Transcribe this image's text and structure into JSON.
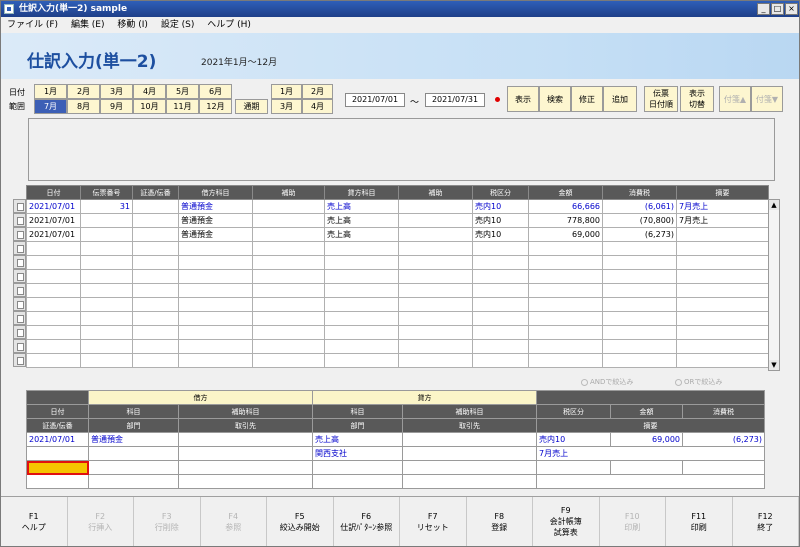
{
  "window": {
    "title": "仕訳入力(単一2) sample",
    "controls": [
      "_",
      "□",
      "×"
    ]
  },
  "menu": [
    "ファイル (F)",
    "編集 (E)",
    "移動 (I)",
    "設定 (S)",
    "ヘルプ (H)"
  ],
  "header": {
    "title": "仕訳入力(単一2)",
    "period": "2021年1月～12月"
  },
  "date_range": {
    "label1": "日付",
    "label2": "範囲",
    "months_row1": [
      "1月",
      "2月",
      "3月",
      "4月",
      "5月",
      "6月"
    ],
    "months_row2": [
      "7月",
      "8月",
      "9月",
      "10月",
      "11月",
      "12月"
    ],
    "selected_month": "7月",
    "period_button": "通期",
    "quarter_row1": [
      "1月",
      "2月"
    ],
    "quarter_row2": [
      "3月",
      "4月"
    ],
    "from": "2021/07/01",
    "tilde": "～",
    "to": "2021/07/31"
  },
  "toolbar": {
    "display": "表示",
    "search": "検索",
    "fix": "修正",
    "add": "追加",
    "voucher_line1": "伝票",
    "voucher_line2": "日付順",
    "toggle_line1": "表示",
    "toggle_line2": "切替",
    "tag_up": "付箋▲",
    "tag_down": "付箋▼"
  },
  "grid": {
    "columns": [
      "日付",
      "伝票番号",
      "証憑/伝番",
      "借方科目",
      "補助",
      "貸方科目",
      "補助",
      "税区分",
      "金額",
      "消費税",
      "摘要"
    ],
    "rows": [
      {
        "date": "2021/07/01",
        "voucher": "31",
        "evidence": "",
        "debit": "普通預金",
        "debit_sub": "",
        "credit": "売上高",
        "credit_sub": "",
        "tax": "売内10",
        "amount": "66,666",
        "ctax": "(6,061)",
        "memo": "7月売上"
      },
      {
        "date": "2021/07/01",
        "voucher": "",
        "evidence": "",
        "debit": "普通預金",
        "debit_sub": "",
        "credit": "売上高",
        "credit_sub": "",
        "tax": "売内10",
        "amount": "778,800",
        "ctax": "(70,800)",
        "memo": "7月売上"
      },
      {
        "date": "2021/07/01",
        "voucher": "",
        "evidence": "",
        "debit": "普通預金",
        "debit_sub": "",
        "credit": "売上高",
        "credit_sub": "",
        "tax": "売内10",
        "amount": "69,000",
        "ctax": "(6,273)",
        "memo": ""
      }
    ]
  },
  "radios": {
    "and": "ANDで絞込み",
    "or": "ORで絞込み"
  },
  "entry": {
    "debit_group": "借方",
    "credit_group": "貸方",
    "h_date": "日付",
    "h_evidence": "証憑/伝番",
    "h_account": "科目",
    "h_sub": "補助科目",
    "h_dept": "部門",
    "h_partner": "取引先",
    "h_tax": "税区分",
    "h_amount": "金額",
    "h_ctax": "消費税",
    "h_memo": "摘要",
    "date": "2021/07/01",
    "debit_account": "普通預金",
    "credit_account": "売上高",
    "credit_dept": "関西支社",
    "tax": "売内10",
    "amount": "69,000",
    "ctax": "(6,273)",
    "memo": "7月売上"
  },
  "fkeys": [
    {
      "key": "F1",
      "label": "ヘルプ",
      "enabled": true
    },
    {
      "key": "F2",
      "label": "行挿入",
      "enabled": false
    },
    {
      "key": "F3",
      "label": "行削除",
      "enabled": false
    },
    {
      "key": "F4",
      "label": "参照",
      "enabled": false
    },
    {
      "key": "F5",
      "label": "絞込み開始",
      "enabled": true
    },
    {
      "key": "F6",
      "label": "仕訳ﾊﾟﾀｰﾝ参照",
      "enabled": true
    },
    {
      "key": "F7",
      "label": "リセット",
      "enabled": true
    },
    {
      "key": "F8",
      "label": "登録",
      "enabled": true
    },
    {
      "key": "F9",
      "label": "会計帳簿",
      "label2": "試算表",
      "enabled": true
    },
    {
      "key": "F10",
      "label": "印刷",
      "enabled": false
    },
    {
      "key": "F11",
      "label": "印刷",
      "enabled": true
    },
    {
      "key": "F12",
      "label": "終了",
      "enabled": true
    }
  ]
}
